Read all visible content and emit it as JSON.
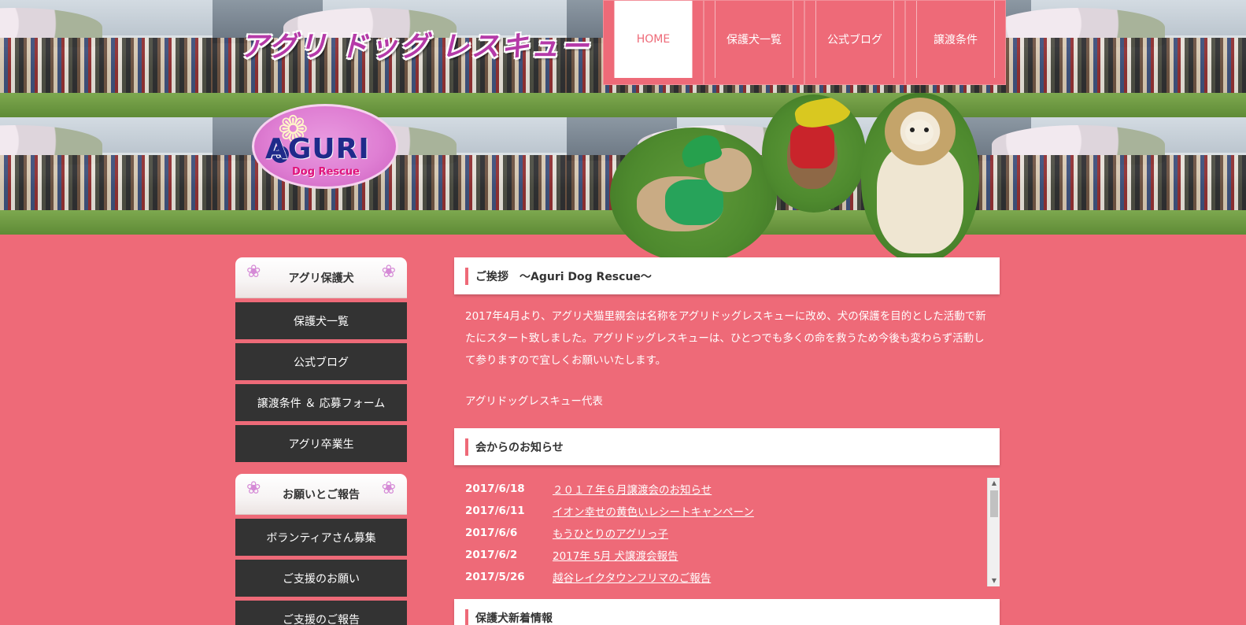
{
  "header": {
    "site_title": "アグリ ドッグ レスキュー",
    "logo": {
      "text_main": "AGURI",
      "text_sub": "Dog Rescue"
    }
  },
  "top_nav": {
    "items": [
      {
        "label": "HOME",
        "active": true
      },
      {
        "label": "保護犬一覧",
        "active": false
      },
      {
        "label": "公式ブログ",
        "active": false
      },
      {
        "label": "譲渡条件",
        "active": false
      }
    ]
  },
  "sidebar": {
    "group1": {
      "heading": "アグリ保護犬",
      "items": [
        "保護犬一覧",
        "公式ブログ",
        "譲渡条件 ＆ 応募フォーム",
        "アグリ卒業生"
      ]
    },
    "group2": {
      "heading": "お願いとご報告",
      "items": [
        "ボランティアさん募集",
        "ご支援のお願い",
        "ご支援のご報告"
      ]
    }
  },
  "main": {
    "greeting_heading": "ご挨拶　～Aguri Dog Rescue～",
    "greeting_text": "2017年4月より、アグリ犬猫里親会は名称をアグリドッグレスキューに改め、犬の保護を目的とした活動で新たにスタート致しました。アグリドッグレスキューは、ひとつでも多くの命を救うため今後も変わらず活動して参りますので宜しくお願いいたします。",
    "signature": "アグリドッグレスキュー代表",
    "news_heading": "会からのお知らせ",
    "news": [
      {
        "date": "2017/6/18",
        "title": "２０１７年６月譲渡会のお知らせ"
      },
      {
        "date": "2017/6/11",
        "title": "イオン幸せの黄色いレシートキャンペーン"
      },
      {
        "date": "2017/6/6",
        "title": "もうひとりのアグリっ子"
      },
      {
        "date": "2017/6/2",
        "title": "2017年 5月 犬譲渡会報告"
      },
      {
        "date": "2017/5/26",
        "title": "越谷レイクタウンフリマのご報告"
      }
    ],
    "new_dogs_heading": "保護犬新着情報"
  },
  "colors": {
    "background": "#ee6a78",
    "sidebar_item": "#333333",
    "accent": "#ee6a78",
    "paw": "#d58ad6"
  }
}
